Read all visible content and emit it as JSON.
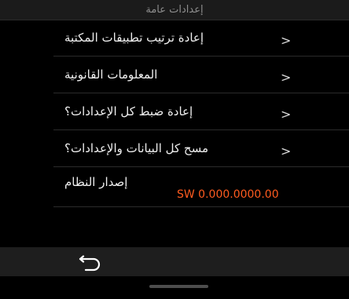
{
  "header": {
    "title": "إعدادات عامة"
  },
  "settings": {
    "items": [
      {
        "label": "إعادة ترتيب تطبيقات المكتبة",
        "chevron": ">"
      },
      {
        "label": "المعلومات القانونية",
        "chevron": ">"
      },
      {
        "label": "إعادة ضبط كل الإعدادات؟",
        "chevron": ">"
      },
      {
        "label": "مسح كل البيانات والإعدادات؟",
        "chevron": ">"
      }
    ],
    "version": {
      "label": "إصدار النظام",
      "value": "SW 0.000.0000.00"
    }
  },
  "navigation": {
    "back_icon": "back-arrow-icon"
  }
}
